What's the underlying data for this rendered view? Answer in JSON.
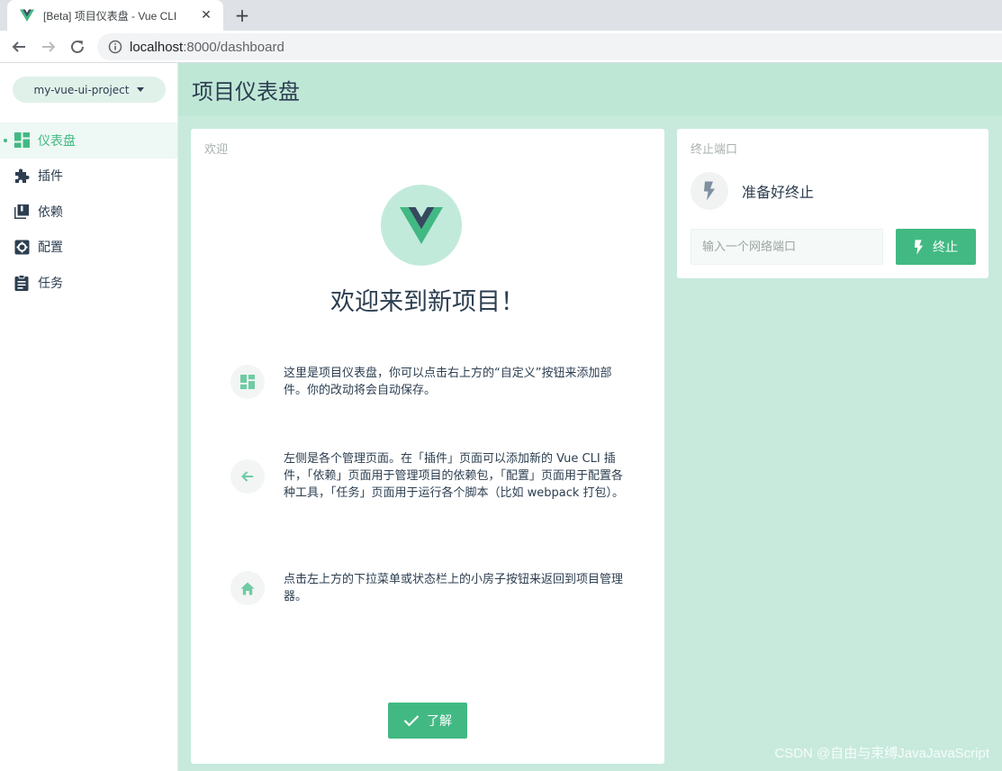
{
  "browser": {
    "tab_title": "[Beta] 项目仪表盘 - Vue CLI",
    "url_host": "localhost",
    "url_path": ":8000/dashboard",
    "close_glyph": "✕",
    "new_tab_glyph": "+"
  },
  "sidebar": {
    "project_name": "my-vue-ui-project",
    "items": [
      {
        "label": "仪表盘",
        "icon": "dashboard-icon",
        "active": true
      },
      {
        "label": "插件",
        "icon": "puzzle-icon"
      },
      {
        "label": "依赖",
        "icon": "library-icon"
      },
      {
        "label": "配置",
        "icon": "settings-icon"
      },
      {
        "label": "任务",
        "icon": "clipboard-icon"
      }
    ]
  },
  "header": {
    "title": "项目仪表盘"
  },
  "welcome": {
    "card_title": "欢迎",
    "heading": "欢迎来到新项目！",
    "tips": [
      {
        "icon": "dashboard-icon",
        "text": "这里是项目仪表盘，你可以点击右上方的“自定义”按钮来添加部件。你的改动将会自动保存。"
      },
      {
        "icon": "arrow-left-icon",
        "text": "左侧是各个管理页面。在「插件」页面可以添加新的 Vue CLI 插件，「依赖」页面用于管理项目的依赖包，「配置」页面用于配置各种工具，「任务」页面用于运行各个脚本（比如 webpack 打包）。"
      },
      {
        "icon": "home-icon",
        "text": "点击左上方的下拉菜单或状态栏上的小房子按钮来返回到项目管理器。"
      }
    ],
    "ok_label": "了解"
  },
  "kill_port": {
    "card_title": "终止端口",
    "status": "准备好终止",
    "input_placeholder": "输入一个网络端口",
    "input_value": "",
    "button_label": "终止"
  },
  "watermark": "CSDN @自由与束缚JavaJavaScript",
  "colors": {
    "accent": "#42b983",
    "main_bg": "#c7eadd",
    "header_bg": "#bfe7d6",
    "text": "#2c3e50"
  }
}
